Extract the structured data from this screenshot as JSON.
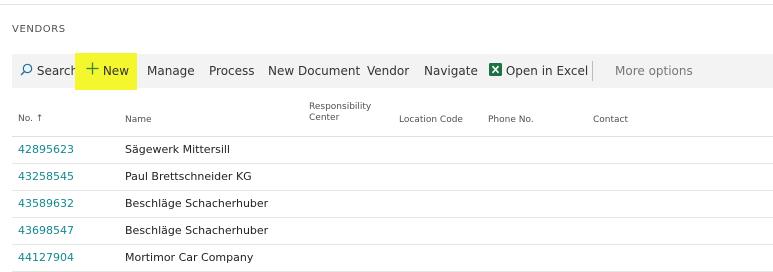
{
  "page": {
    "title": "VENDORS"
  },
  "toolbar": {
    "search": "Search",
    "new": "New",
    "manage": "Manage",
    "process": "Process",
    "new_document": "New Document",
    "vendor": "Vendor",
    "navigate": "Navigate",
    "open_in_excel": "Open in Excel",
    "more_options": "More options",
    "highlight_color": "#f4f72e"
  },
  "grid": {
    "columns": {
      "no": "No.",
      "no_sort": "↑",
      "name": "Name",
      "responsibility_center_1": "Responsibility",
      "responsibility_center_2": "Center",
      "location_code": "Location Code",
      "phone_no": "Phone No.",
      "contact": "Contact"
    },
    "rows": [
      {
        "no": "42895623",
        "name": "Sägewerk Mittersill"
      },
      {
        "no": "43258545",
        "name": "Paul Brettschneider KG"
      },
      {
        "no": "43589632",
        "name": "Beschläge Schacherhuber"
      },
      {
        "no": "43698547",
        "name": "Beschläge Schacherhuber"
      },
      {
        "no": "44127904",
        "name": "Mortimor Car Company"
      }
    ]
  },
  "colors": {
    "link": "#14898f",
    "excel_green": "#1e7145",
    "accent_green": "#2e8b3a"
  }
}
